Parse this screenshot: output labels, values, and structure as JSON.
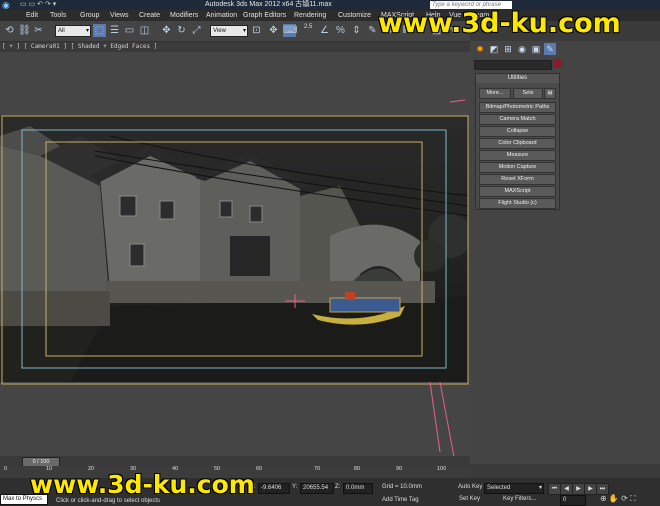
{
  "window": {
    "title": "Autodesk 3ds Max  2012 x64      古镇11.max",
    "search_placeholder": "Type a keyword or phrase"
  },
  "menu": [
    "Edit",
    "Tools",
    "Group",
    "Views",
    "Create",
    "Modifiers",
    "Animation",
    "Graph Editors",
    "Rendering",
    "Customize",
    "MAXScript",
    "Help",
    "Vue xStream"
  ],
  "toolbar": {
    "selection_filter": "All",
    "reference_coord": "View",
    "snap_value": "2.5"
  },
  "viewport": {
    "label": "[ + ] [ Camera01 ] [ Shaded + Edged Faces ]"
  },
  "command_panel": {
    "rollout_title": "Utilities",
    "more_label": "More...",
    "sets_label": "Sets",
    "utilities": [
      "Bitmap/Photometric Paths",
      "Camera Match",
      "Collapse",
      "Color Clipboard",
      "Measure",
      "Motion Capture",
      "Reset XForm",
      "MAXScript",
      "Flight Studio (c)"
    ]
  },
  "timeline": {
    "frame_display": "0 / 100",
    "ticks": [
      "0",
      "10",
      "20",
      "30",
      "40",
      "50",
      "60",
      "70",
      "80",
      "90",
      "100"
    ]
  },
  "status": {
    "welcome": "Max to Physcs",
    "prompt": "Click or click-and-drag to select objects",
    "x_label": "X:",
    "x_value": "-9.6406",
    "y_label": "Y:",
    "y_value": "20655.54",
    "z_label": "Z:",
    "z_value": "0.0mm",
    "grid": "Grid = 10.0mm",
    "add_time_tag": "Add Time Tag",
    "auto_key": "Auto Key",
    "set_key": "Set Key",
    "key_mode": "Selected",
    "key_filters": "Key Filters...",
    "frame_value": "0"
  },
  "watermark": {
    "top": "www.3d-ku.com",
    "bottom": "www.3d-ku.com"
  },
  "colors": {
    "accent_yellow": "#ffe800",
    "camera_frame": "#7fb8c8",
    "safe_frame": "#c8b060",
    "swatch": "#8b1a2e"
  }
}
